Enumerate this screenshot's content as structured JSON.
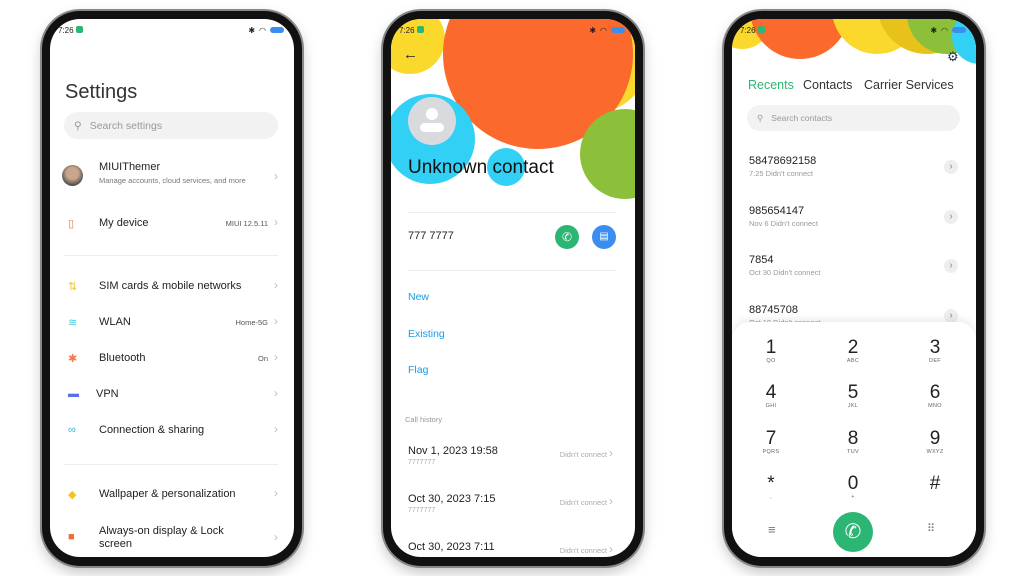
{
  "status": {
    "time": "7:26"
  },
  "settings": {
    "title": "Settings",
    "search_placeholder": "Search settings",
    "account": {
      "name": "MIUIThemer",
      "subtitle": "Manage accounts, cloud services, and more"
    },
    "items": [
      {
        "label": "My device",
        "value": "MIUI 12.5.11",
        "icon": "phone-icon",
        "color": "#f07a4a"
      },
      {
        "label": "SIM cards & mobile networks",
        "value": "",
        "icon": "sim-arrows-icon",
        "color": "#f5c31c"
      },
      {
        "label": "WLAN",
        "value": "Home-5G",
        "icon": "wifi-icon",
        "color": "#45c6e8"
      },
      {
        "label": "Bluetooth",
        "value": "On",
        "icon": "bluetooth-icon",
        "color": "#f07a4a"
      },
      {
        "label": "VPN",
        "value": "",
        "icon": "vpn-icon",
        "color": "#5b6ee8"
      },
      {
        "label": "Connection & sharing",
        "value": "",
        "icon": "link-icon",
        "color": "#3ab3e8"
      },
      {
        "label": "Wallpaper & personalization",
        "value": "",
        "icon": "wallpaper-icon",
        "color": "#f5c31c"
      },
      {
        "label": "Always-on display & Lock screen",
        "value": "",
        "icon": "lock-icon",
        "color": "#f26a3a"
      }
    ]
  },
  "contact": {
    "name": "Unknown contact",
    "number": "777 7777",
    "actions": [
      "New",
      "Existing",
      "Flag"
    ],
    "call_history_label": "Call history",
    "history": [
      {
        "date": "Nov 1, 2023 19:58",
        "number": "7777777",
        "status": "Didn't connect"
      },
      {
        "date": "Oct 30, 2023 7:15",
        "number": "7777777",
        "status": "Didn't connect"
      },
      {
        "date": "Oct 30, 2023 7:11",
        "number": "",
        "status": "Didn't connect"
      }
    ],
    "link_color": "#1a9be6"
  },
  "dialer": {
    "tabs": [
      {
        "label": "Recents",
        "active": true
      },
      {
        "label": "Contacts",
        "active": false
      },
      {
        "label": "Carrier Services",
        "active": false
      }
    ],
    "accent": "#2bb673",
    "search_placeholder": "Search contacts",
    "recents": [
      {
        "number": "58478692158",
        "detail": "7:25 Didn't connect"
      },
      {
        "number": "985654147",
        "detail": "Nov 6 Didn't connect"
      },
      {
        "number": "7854",
        "detail": "Oct 30 Didn't connect"
      },
      {
        "number": "88745708",
        "detail": "Oct 10 Didn't connect"
      }
    ],
    "keys": [
      {
        "digit": "1",
        "letters": "QO"
      },
      {
        "digit": "2",
        "letters": "ABC"
      },
      {
        "digit": "3",
        "letters": "DEF"
      },
      {
        "digit": "4",
        "letters": "GHI"
      },
      {
        "digit": "5",
        "letters": "JKL"
      },
      {
        "digit": "6",
        "letters": "MNO"
      },
      {
        "digit": "7",
        "letters": "PQRS"
      },
      {
        "digit": "8",
        "letters": "TUV"
      },
      {
        "digit": "9",
        "letters": "WXYZ"
      },
      {
        "digit": "*",
        "letters": ","
      },
      {
        "digit": "0",
        "letters": "+"
      },
      {
        "digit": "#",
        "letters": ""
      }
    ]
  }
}
